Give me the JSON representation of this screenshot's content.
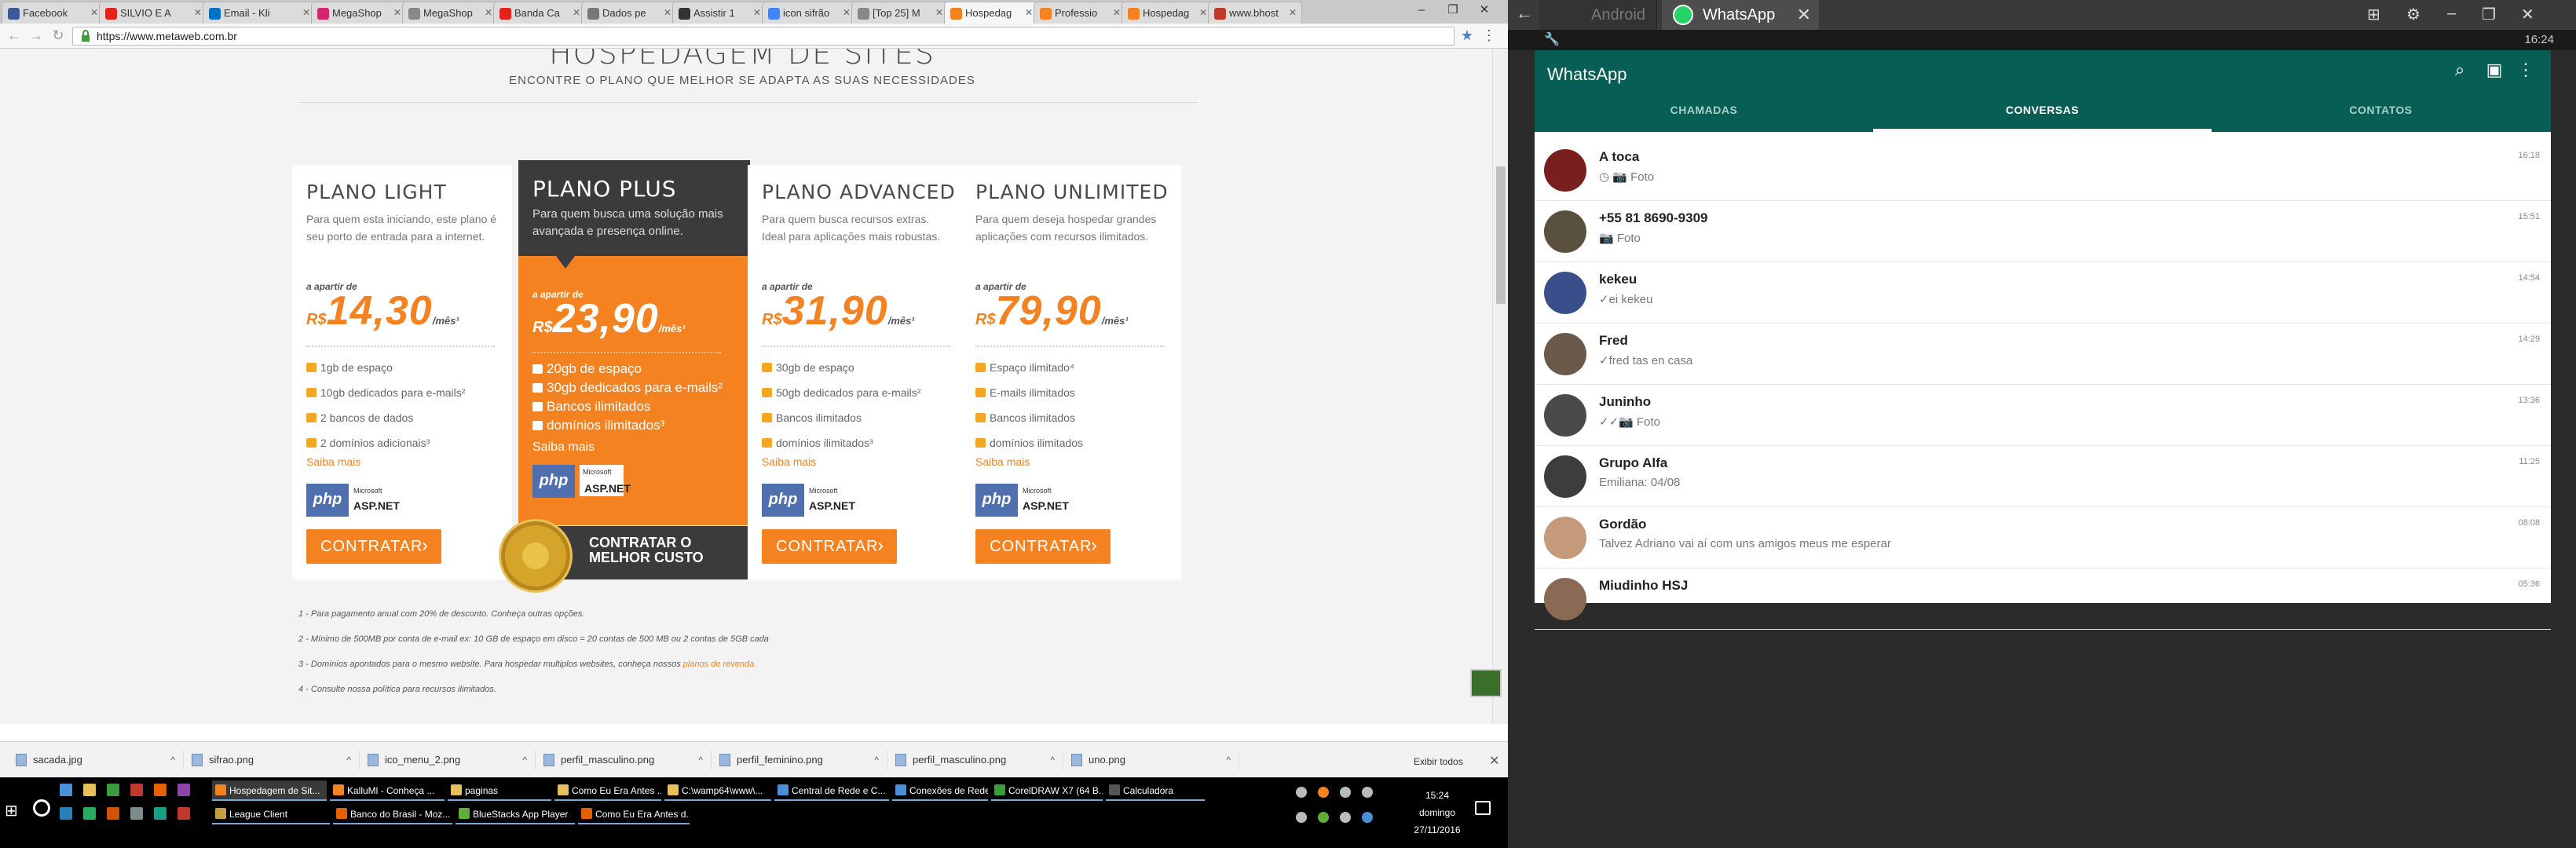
{
  "browser": {
    "tabs": [
      {
        "label": "Facebook",
        "color": "#3b5998"
      },
      {
        "label": "SILVIO E A",
        "color": "#e62117"
      },
      {
        "label": "Email - Kli",
        "color": "#0072c6"
      },
      {
        "label": "MegaShop",
        "color": "#d6246e"
      },
      {
        "label": "MegaShop",
        "color": "#888888"
      },
      {
        "label": "Banda Ca",
        "color": "#e62117"
      },
      {
        "label": "Dados pe",
        "color": "#777777"
      },
      {
        "label": "Assistir 1",
        "color": "#333333"
      },
      {
        "label": "icon sifrão",
        "color": "#4285f4"
      },
      {
        "label": "[Top 25] M",
        "color": "#888888"
      },
      {
        "label": "Hospedag",
        "color": "#f58220"
      },
      {
        "label": "Professio",
        "color": "#f58220"
      },
      {
        "label": "Hospedag",
        "color": "#f58220"
      },
      {
        "label": "www.bhost",
        "color": "#c0392b"
      }
    ],
    "url": "https://www.metaweb.com.br",
    "heading": "HOSPEDAGEM DE SITES",
    "subheading": "ENCONTRE O PLANO QUE MELHOR SE ADAPTA AS SUAS NECESSIDADES",
    "plans": [
      {
        "name": "PLANO LIGHT",
        "desc": "Para quem esta iniciando, este plano é seu porto de entrada para a internet.",
        "apartir": "a apartir de",
        "currency": "R$",
        "price": "14,30",
        "per": "/mês¹",
        "features": [
          "1gb de espaço",
          "10gb dedicados para e-mails²",
          "2 bancos de dados",
          "2 domínios adicionais³"
        ],
        "saiba": "Saiba mais",
        "ms": "Microsoft",
        "asp": "ASP.NET",
        "php": "php",
        "button": "CONTRATAR"
      },
      {
        "name": "PLANO PLUS",
        "desc": "Para quem busca uma solução mais avançada e presença online.",
        "apartir": "a apartir de",
        "currency": "R$",
        "price": "23,90",
        "per": "/mês¹",
        "features": [
          "20gb de espaço",
          "30gb dedicados para e-mails²",
          "Bancos ilimitados",
          "domínios ilimitados³"
        ],
        "saiba": "Saiba mais",
        "ms": "Microsoft",
        "asp": "ASP.NET",
        "php": "php",
        "button": "CONTRATAR O MELHOR CUSTO"
      },
      {
        "name": "PLANO ADVANCED",
        "desc": "Para quem busca recursos extras. Ideal para aplicações mais robustas.",
        "apartir": "a apartir de",
        "currency": "R$",
        "price": "31,90",
        "per": "/mês¹",
        "features": [
          "30gb de espaço",
          "50gb dedicados para e-mails²",
          "Bancos ilimitados",
          "domínios ilimitados³"
        ],
        "saiba": "Saiba mais",
        "ms": "Microsoft",
        "asp": "ASP.NET",
        "php": "php",
        "button": "CONTRATAR"
      },
      {
        "name": "PLANO UNLIMITED",
        "desc": "Para quem deseja hospedar grandes aplicações com recursos ilimitados.",
        "apartir": "a apartir de",
        "currency": "R$",
        "price": "79,90",
        "per": "/mês¹",
        "features": [
          "Espaço ilimitado⁴",
          "E-mails ilimitados",
          "Bancos ilimitados",
          "domínios ilimitados"
        ],
        "saiba": "Saiba mais",
        "ms": "Microsoft",
        "asp": "ASP.NET",
        "php": "php",
        "button": "CONTRATAR"
      }
    ],
    "footnotes": [
      "1 - Para pagamento anual com 20% de desconto. Conheça outras opções.",
      "2 - Mínimo de 500MB por conta de e-mail ex: 10 GB de espaço em disco = 20 contas de 500 MB ou 2 contas de 5GB cada",
      "3 - Domínios apontados para o mesmo website. Para hospedar multiplos websites, conheça nossos",
      "4 - Consulte nossa política para recursos ilimitados."
    ],
    "footnote_link": "planos de revenda.",
    "downloads": [
      "sacada.jpg",
      "sifrao.png",
      "ico_menu_2.png",
      "perfil_masculino.png",
      "perfil_feminino.png",
      "perfil_masculino.png",
      "uno.png"
    ],
    "show_all": "Exibir todos"
  },
  "bluestacks": {
    "tab_android": "Android",
    "tab_whatsapp": "WhatsApp",
    "status_time": "16:24"
  },
  "whatsapp": {
    "title": "WhatsApp",
    "tabs": [
      "CHAMADAS",
      "CONVERSAS",
      "CONTATOS"
    ],
    "chats": [
      {
        "name": "A toca",
        "msg": "◷ 📷 Foto",
        "time": "16:18",
        "avatar": "#7a1f1f"
      },
      {
        "name": "+55 81 8690-9309",
        "msg": "📷 Foto",
        "time": "15:51",
        "avatar": "#5a5040"
      },
      {
        "name": "kekeu",
        "msg": "✓ei kekeu",
        "time": "14:54",
        "avatar": "#3a4e8c"
      },
      {
        "name": "Fred",
        "msg": "✓fred tas en casa",
        "time": "14:29",
        "avatar": "#6b5a4a"
      },
      {
        "name": "Juninho",
        "msg": "✓✓📷 Foto",
        "time": "13:36",
        "avatar": "#4a4a4a"
      },
      {
        "name": "Grupo Alfa",
        "msg": "Emiliana: 04/08",
        "time": "11:25",
        "avatar": "#3d3d3d"
      },
      {
        "name": "Gordão",
        "msg": "Talvez Adriano vai aí com uns amigos meus me esperar",
        "time": "08:08",
        "avatar": "#c49a7a"
      },
      {
        "name": "Miudinho HSJ",
        "msg": "",
        "time": "05:36",
        "avatar": "#8a6a55"
      }
    ]
  },
  "taskbar": {
    "row1": [
      {
        "label": "Hospedagem de Sit...",
        "color": "#f58220"
      },
      {
        "label": "KalluMl - Conheça ...",
        "color": "#f58220"
      },
      {
        "label": "paginas",
        "color": "#e8c05a"
      },
      {
        "label": "Como Eu Era Antes ...",
        "color": "#e8c05a"
      },
      {
        "label": "C:\\wamp64\\www\\...",
        "color": "#e8c05a"
      },
      {
        "label": "Central de Rede e C...",
        "color": "#4a90d9"
      },
      {
        "label": "Conexões de Rede",
        "color": "#4a90d9"
      },
      {
        "label": "CorelDRAW X7 (64 B...",
        "color": "#3a9d3a"
      },
      {
        "label": "Calculadora",
        "color": "#555555"
      }
    ],
    "row2": [
      {
        "label": "League Client",
        "color": "#c8a040"
      },
      {
        "label": "Banco do Brasil - Moz...",
        "color": "#e66000"
      },
      {
        "label": "BlueStacks App Player",
        "color": "#5fae3a"
      },
      {
        "label": "Como Eu Era Antes d...",
        "color": "#e66000"
      }
    ],
    "clock_time": "15:24",
    "clock_day": "domingo",
    "clock_date": "27/11/2016"
  }
}
